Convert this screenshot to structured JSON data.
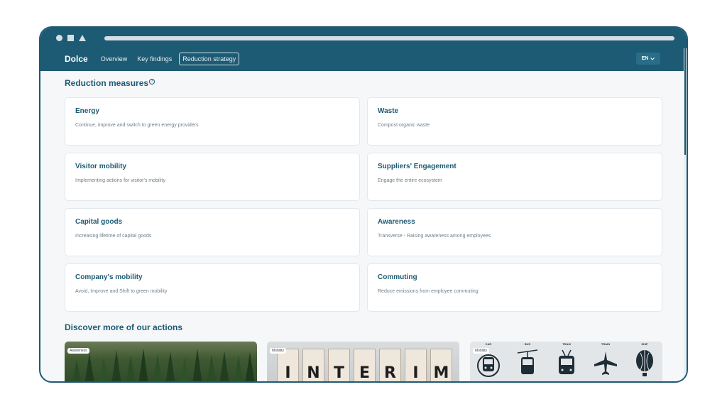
{
  "nav": {
    "brand": "Dolce",
    "links": [
      "Overview",
      "Key findings",
      "Reduction strategy"
    ],
    "language": "EN"
  },
  "reduction": {
    "title": "Reduction measures",
    "help_glyph": "?",
    "measures": [
      {
        "title": "Energy",
        "desc": "Continue, improve and switch to green energy providers"
      },
      {
        "title": "Waste",
        "desc": "Compost organic waste"
      },
      {
        "title": "Visitor mobility",
        "desc": "Implementing actions for visitor's mobility"
      },
      {
        "title": "Suppliers' Engagement",
        "desc": "Engage the entire ecosystem"
      },
      {
        "title": "Capital goods",
        "desc": "Increasing lifetime of capital goods"
      },
      {
        "title": "Awareness",
        "desc": "Transverse - Raising awareness among employees"
      },
      {
        "title": "Company's mobility",
        "desc": "Avoid, Improve and Shift to green mobility"
      },
      {
        "title": "Commuting",
        "desc": "Reduce emissions from employee commuting"
      }
    ]
  },
  "discover": {
    "title": "Discover more of our actions",
    "tiles": [
      {
        "badge": "Awareness"
      },
      {
        "badge": "Mobility",
        "letters": [
          "I",
          "N",
          "T",
          "E",
          "R",
          "I",
          "M"
        ]
      },
      {
        "badge": "Mobility",
        "modes": [
          "CAR",
          "BUS",
          "TRAM",
          "TRAIN",
          "SHIP"
        ]
      }
    ]
  },
  "colors": {
    "primary": "#1d5a73",
    "text_muted": "#6e7f8a"
  }
}
